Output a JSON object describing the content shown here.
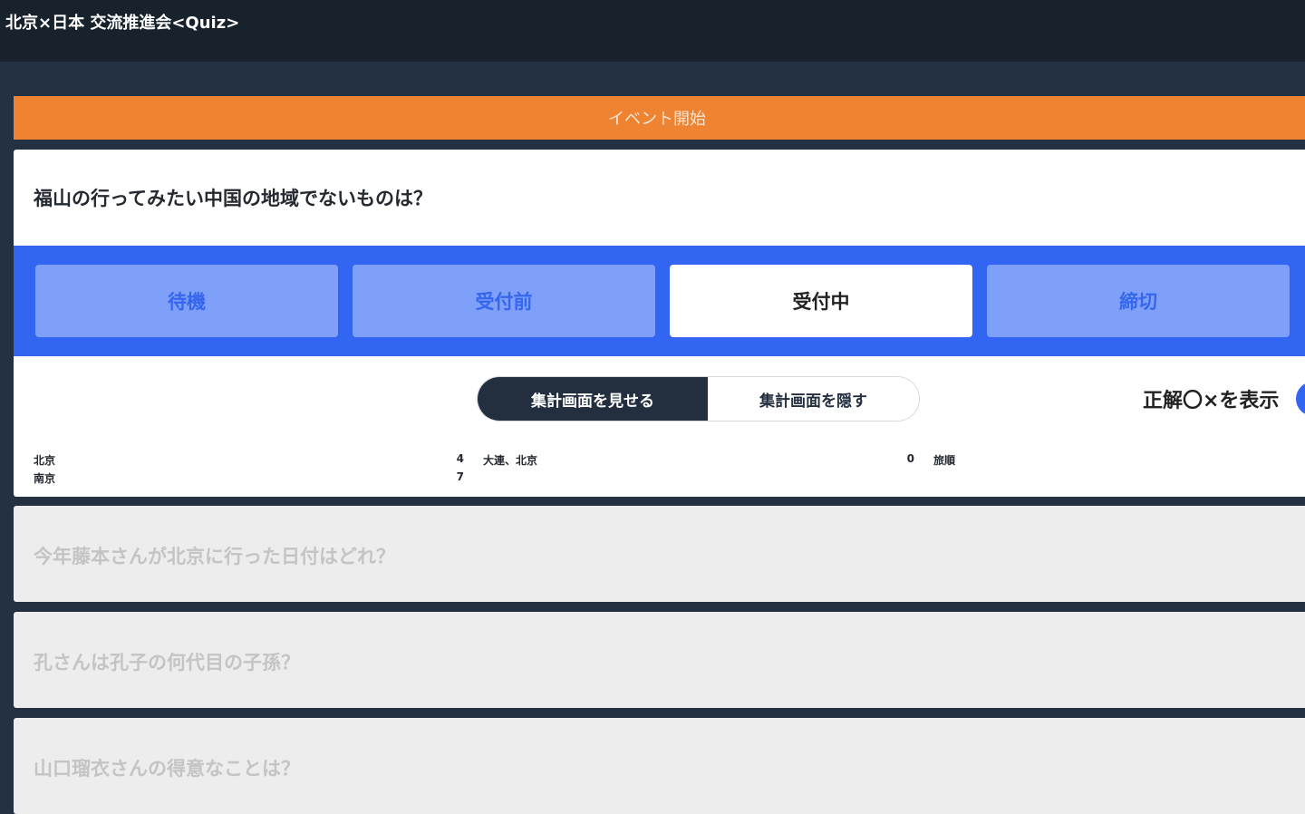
{
  "header": {
    "title": "北京×日本 交流推進会<Quiz>"
  },
  "banner": {
    "label": "イベント開始"
  },
  "active_question": {
    "text": "福山の行ってみたい中国の地域でないものは？",
    "status_buttons": [
      {
        "label": "待機",
        "active": false
      },
      {
        "label": "受付前",
        "active": false
      },
      {
        "label": "受付中",
        "active": true
      },
      {
        "label": "締切",
        "active": false
      }
    ],
    "summary_toggle": {
      "show_label": "集計画面を見せる",
      "hide_label": "集計画面を隠す",
      "selected": "show"
    },
    "answer_display_label": "正解〇×を表示",
    "results": [
      {
        "choice": "北京",
        "count": "4"
      },
      {
        "choice": "大連、北京",
        "count": "0"
      },
      {
        "choice": "旅順",
        "count": ""
      },
      {
        "choice": "南京",
        "count": "7"
      }
    ]
  },
  "other_questions": [
    {
      "text": "今年藤本さんが北京に行った日付はどれ？"
    },
    {
      "text": "孔さんは孔子の何代目の子孫？"
    },
    {
      "text": "山口瑠衣さんの得意なことは？"
    }
  ],
  "colors": {
    "header_bg": "#18222c",
    "page_bg": "#243142",
    "banner": "#ee8332",
    "status_bar": "#3266f2",
    "status_inactive": "#7fa0f8",
    "toggle_active": "#232f3e",
    "inactive_card": "#ededed"
  }
}
